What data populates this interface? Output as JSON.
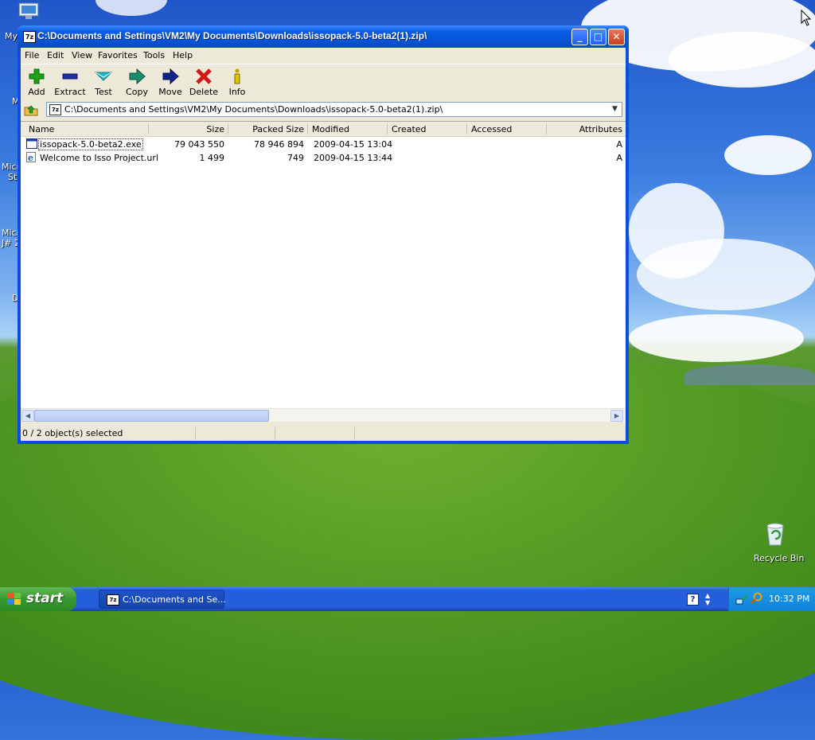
{
  "desktop": {
    "icon_labels_cut": [
      "My",
      "M",
      "Micr",
      "St",
      "Micr",
      "J# 2",
      "D"
    ],
    "recycle_bin_label": "Recycle Bin"
  },
  "window": {
    "title": "C:\\Documents and Settings\\VM2\\My Documents\\Downloads\\issopack-5.0-beta2(1).zip\\",
    "app_icon_text": "7z",
    "buttons": {
      "minimize": "_",
      "maximize": "□",
      "close": "✕"
    }
  },
  "menu": [
    "File",
    "Edit",
    "View",
    "Favorites",
    "Tools",
    "Help"
  ],
  "toolbar": [
    {
      "label": "Add",
      "icon": "add-icon",
      "color": "#1aa21a"
    },
    {
      "label": "Extract",
      "icon": "extract-icon",
      "color": "#1a2fa6"
    },
    {
      "label": "Test",
      "icon": "test-icon",
      "color": "#1fb8c8"
    },
    {
      "label": "Copy",
      "icon": "copy-icon",
      "color": "#1d8a6c"
    },
    {
      "label": "Move",
      "icon": "move-icon",
      "color": "#13238f"
    },
    {
      "label": "Delete",
      "icon": "delete-icon",
      "color": "#d01818"
    },
    {
      "label": "Info",
      "icon": "info-icon",
      "color": "#b8a000"
    }
  ],
  "address": {
    "value": "C:\\Documents and Settings\\VM2\\My Documents\\Downloads\\issopack-5.0-beta2(1).zip\\"
  },
  "columns": [
    "Name",
    "Size",
    "Packed Size",
    "Modified",
    "Created",
    "Accessed",
    "Attributes"
  ],
  "files": [
    {
      "name": "issopack-5.0-beta2.exe",
      "size": "79 043 550",
      "packed": "78 946 894",
      "modified": "2009-04-15 13:04",
      "created": "",
      "accessed": "",
      "attributes": "A",
      "icon": "exe-file-icon"
    },
    {
      "name": "Welcome to Isso Project.url",
      "size": "1 499",
      "packed": "749",
      "modified": "2009-04-15 13:44",
      "created": "",
      "accessed": "",
      "attributes": "A",
      "icon": "url-file-icon"
    }
  ],
  "status": {
    "selection": "0 / 2 object(s) selected"
  },
  "taskbar": {
    "start_label": "start",
    "task_label": "C:\\Documents and Se...",
    "clock": "10:32 PM"
  }
}
